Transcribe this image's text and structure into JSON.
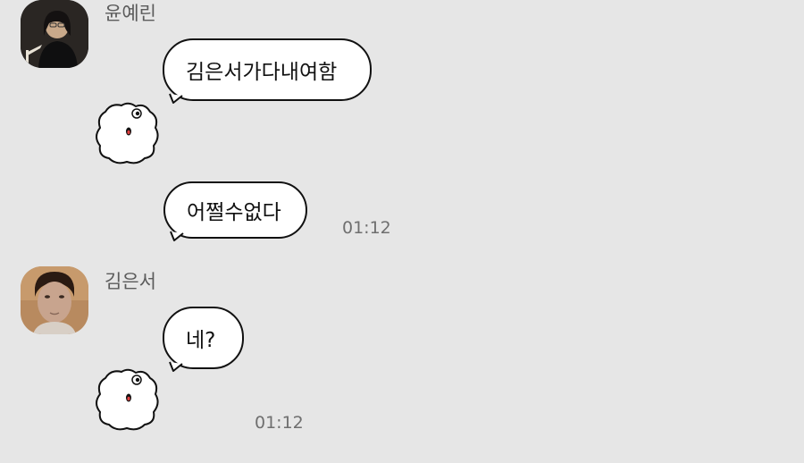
{
  "chat": {
    "groups": [
      {
        "sender": "윤예린",
        "avatar_icon": "profile-photo-person-dark-background",
        "messages": [
          {
            "type": "text",
            "text": "김은서가다내여함"
          },
          {
            "type": "sticker",
            "icon": "white-fluffy-character-sticker"
          },
          {
            "type": "text",
            "text": "어쩔수없다",
            "time": "01:12"
          }
        ]
      },
      {
        "sender": "김은서",
        "avatar_icon": "profile-photo-person-face",
        "messages": [
          {
            "type": "text",
            "text": "네?"
          },
          {
            "type": "sticker",
            "icon": "white-fluffy-character-sticker",
            "time": "01:12"
          }
        ]
      }
    ]
  },
  "colors": {
    "background": "#e6e6e6",
    "bubble": "#ffffff",
    "bubble_border": "#111111",
    "sender_text": "#5b5b5b",
    "time_text": "#6f6f6f"
  }
}
